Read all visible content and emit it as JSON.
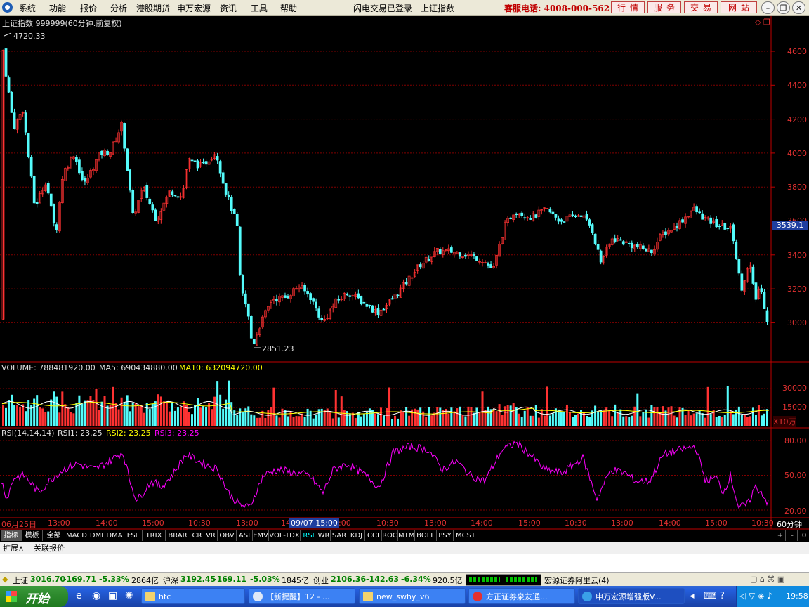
{
  "menubar": {
    "items": [
      "系统",
      "功能",
      "报价",
      "分析",
      "港股期货",
      "申万宏源",
      "资讯",
      "工具",
      "帮助"
    ],
    "status1": "闪电交易已登录",
    "status2": "上证指数",
    "phone": "客服电话: 4008-000-562",
    "buttons": [
      "行情",
      "服务",
      "交易",
      "网站"
    ]
  },
  "chart": {
    "title": "上证指数 999999(60分钟.前复权)",
    "high_label": "4720.33",
    "low_label": "2851.23",
    "price_axis": [
      "4600",
      "4400",
      "4200",
      "4000",
      "3800",
      "3600",
      "3400",
      "3200",
      "3000"
    ],
    "current_price": "3539.1",
    "volume_label": "VOLUME: 788481920.00",
    "ma5_label": "MA5: 690434880.00",
    "ma10_label": "MA10: 632094720.00",
    "volume_axis": [
      "30000",
      "15000"
    ],
    "volume_unit": "X10万",
    "rsi_label": "RSI(14,14,14)",
    "rsi1_label": "RSI1: 23.25",
    "rsi2_label": "RSI2: 23.25",
    "rsi3_label": "RSI3: 23.25",
    "rsi_axis": [
      "80.00",
      "50.00",
      "20.00"
    ],
    "time_axis": [
      "06月25日",
      "13:00",
      "14:00",
      "15:00",
      "10:30",
      "13:00",
      "14:00",
      "15:00",
      "10:30",
      "13:00",
      "14:00",
      "15:00",
      "10:30",
      "13:00",
      "14:00",
      "15:00",
      "10:30"
    ],
    "cursor_time": "09/07 15:00",
    "period": "60分钟"
  },
  "tabs": [
    "指标",
    "模板",
    "全部",
    "MACD",
    "DMI",
    "DMA",
    "FSL",
    "TRIX",
    "BRAR",
    "CR",
    "VR",
    "OBV",
    "ASI",
    "EMV",
    "VOL-TDX",
    "RSI",
    "WR",
    "SAR",
    "KDJ",
    "CCI",
    "ROC",
    "MTM",
    "BOLL",
    "PSY",
    "MCST"
  ],
  "tab_controls": [
    "+",
    "-",
    "0"
  ],
  "extension": [
    "扩展∧",
    "关联报价"
  ],
  "statusbar": {
    "sh_name": "上证",
    "sh_price": "3016.70",
    "sh_chg": "-169.71",
    "sh_pct": "-5.33%",
    "sh_amt": "2864亿",
    "hs_name": "沪深",
    "hs_price": "3192.45",
    "hs_chg": "-169.11",
    "hs_pct": "-5.03%",
    "hs_amt": "1845亿",
    "cy_name": "创业",
    "cy_price": "2106.36",
    "cy_chg": "-142.63",
    "cy_pct": "-6.34%",
    "cy_amt": "920.5亿",
    "server": "宏源证券阿里云(4)"
  },
  "taskbar": {
    "start": "开始",
    "tasks": [
      "htc",
      "【新提醒】12 - ...",
      "new_swhy_v6",
      "方正证券泉友通...",
      "申万宏源增强版V..."
    ],
    "clock": "19:58"
  },
  "colors": {
    "up": "#ff3232",
    "down": "#54fcfc",
    "ma5": "#ffffff",
    "ma10": "#ffff00",
    "rsi": "#ff00ff",
    "grid": "#7f0000"
  }
}
